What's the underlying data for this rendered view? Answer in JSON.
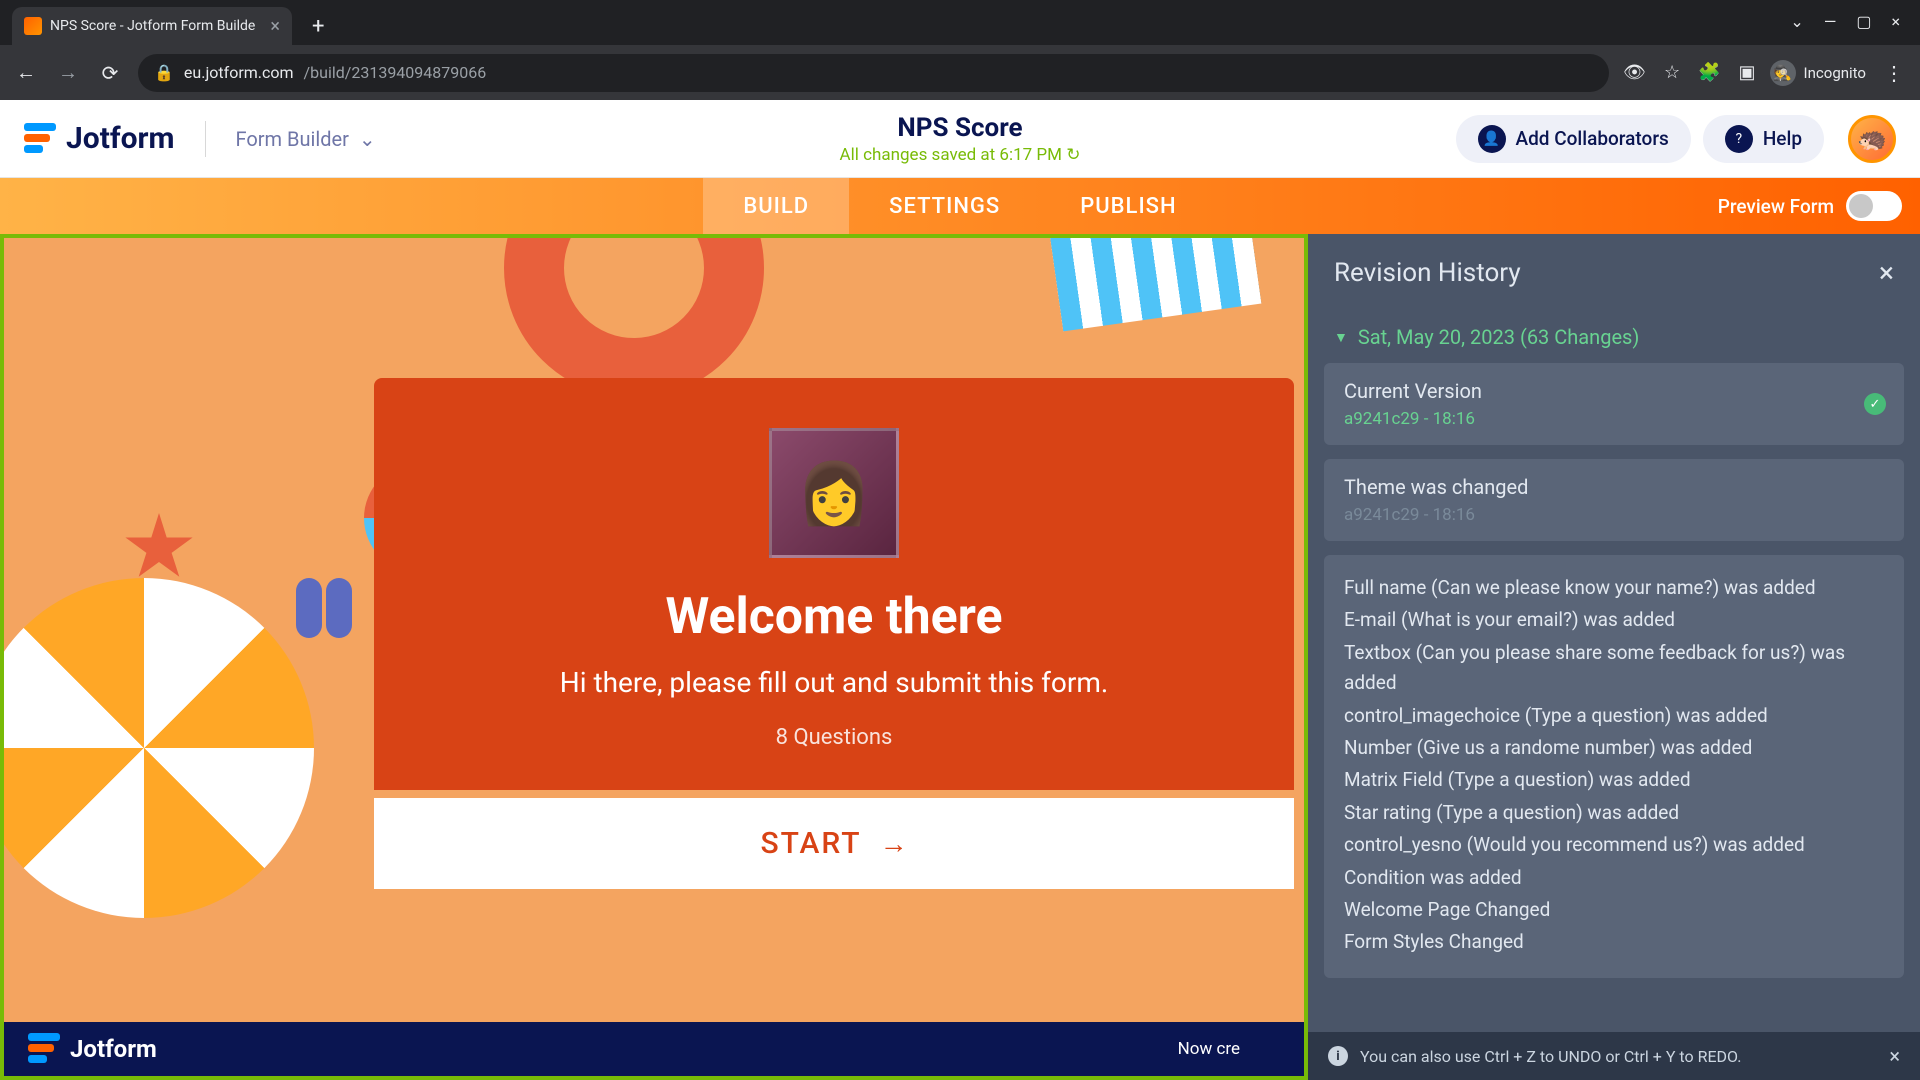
{
  "browser": {
    "tab_title": "NPS Score - Jotform Form Builde",
    "url_domain": "eu.jotform.com",
    "url_path": "/build/231394094879066",
    "incognito_label": "Incognito"
  },
  "header": {
    "logo_text": "Jotform",
    "builder_label": "Form Builder",
    "form_title": "NPS Score",
    "save_status": "All changes saved at 6:17 PM ↻",
    "collaborators_label": "Add Collaborators",
    "help_label": "Help"
  },
  "tabs": {
    "build": "BUILD",
    "settings": "SETTINGS",
    "publish": "PUBLISH",
    "preview_label": "Preview Form"
  },
  "form_preview": {
    "welcome_title": "Welcome there",
    "welcome_subtitle": "Hi there, please fill out and submit this form.",
    "question_count": "8 Questions",
    "start_label": "START"
  },
  "footer": {
    "logo_text": "Jotform",
    "banner_text": "Now cre"
  },
  "revision_panel": {
    "title": "Revision History",
    "date_header": "Sat, May 20, 2023 (63 Changes)",
    "items": [
      {
        "title": "Current Version",
        "meta": "a9241c29 - 18:16",
        "current": true
      },
      {
        "title": "Theme was changed",
        "meta": "a9241c29 - 18:16",
        "current": false
      }
    ],
    "details": [
      "Full name (Can we please know your name?) was added",
      "E-mail (What is your email?) was added",
      "Textbox (Can you please share some feedback for us?) was added",
      "control_imagechoice (Type a question) was added",
      "Number (Give us a randome number) was added",
      "Matrix Field (Type a question) was added",
      "Star rating (Type a question) was added",
      "control_yesno (Would you recommend us?) was added",
      "Condition was added",
      "Welcome Page Changed",
      "Form Styles Changed"
    ]
  },
  "toast": {
    "message": "You can also use Ctrl + Z to UNDO or Ctrl + Y to REDO."
  }
}
